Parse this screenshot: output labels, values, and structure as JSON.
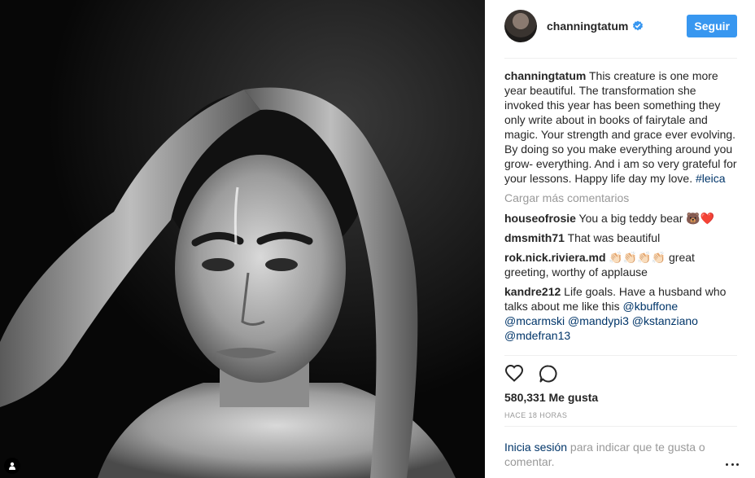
{
  "post": {
    "author": "channingtatum",
    "follow_label": "Seguir",
    "caption_user": "channingtatum",
    "caption_text": "This creature is one more year beautiful. The transformation she invoked this year has been something they only write about in books of fairytale and magic. Your strength and grace ever evolving. By doing so you make everything around you grow- everything. And i am so very grateful for your lessons. Happy life day my love. ",
    "caption_hashtag": "#leica",
    "load_more": "Cargar más comentarios",
    "comments": [
      {
        "user": "houseofrosie",
        "text": "You a big teddy bear 🐻❤️"
      },
      {
        "user": "dmsmith71",
        "text": "That was beautiful"
      },
      {
        "user": "rok.nick.riviera.md",
        "text": "👏🏻👏🏻👏🏻👏🏻 great greeting, worthy of applause"
      },
      {
        "user": "kandre212",
        "text": "Life goals. Have a husband who talks about me like this ",
        "mentions": "@kbuffone @mcarmski @mandypi3 @kstanziano @mdefran13"
      }
    ],
    "likes": "580,331 Me gusta",
    "time": "HACE 18 HORAS",
    "login_link": "Inicia sesión",
    "login_text": " para indicar que te gusta o comentar."
  },
  "icons": {
    "verified": "verified-badge-icon",
    "like": "heart-outline-icon",
    "comment": "comment-bubble-icon",
    "tag": "user-tag-icon",
    "more": "more-options-icon"
  },
  "colors": {
    "accent": "#3897f0",
    "link": "#003569",
    "muted": "#999999"
  }
}
